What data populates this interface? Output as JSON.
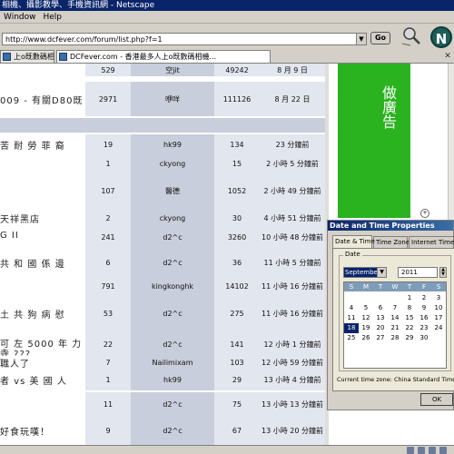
{
  "window": {
    "title": "相機、攝影教學、手機資訊網 - Netscape"
  },
  "menu": {
    "items": [
      "Window",
      "Help"
    ]
  },
  "toolbar": {
    "url": "http://www.dcfever.com/forum/list.php?f=1",
    "go_label": "Go"
  },
  "tabs": [
    {
      "label": "上o既數碼相機..."
    },
    {
      "label": "DCFever.com - 香港最多人上o既數碼相機..."
    }
  ],
  "forum": {
    "rows": [
      {
        "title": "",
        "replies": "529",
        "author": "空jit",
        "views": "49242",
        "last": "8 月 9 日"
      },
      {
        "title": "009 - 有關D80既",
        "replies": "2971",
        "author": "咿咩",
        "views": "111126",
        "last": "8 月 22 日"
      },
      {
        "title": "苦 耐 勞 菲 裔",
        "replies": "19",
        "author": "hk99",
        "views": "134",
        "last": "23 分鐘前"
      },
      {
        "title": "",
        "replies": "1",
        "author": "ckyong",
        "views": "15",
        "last": "2 小時 5 分鐘前"
      },
      {
        "title": "",
        "replies": "107",
        "author": "醫德",
        "views": "1052",
        "last": "2 小時 49 分鐘前"
      },
      {
        "title": "天祥黑店",
        "replies": "2",
        "author": "ckyong",
        "views": "30",
        "last": "4 小時 51 分鐘前"
      },
      {
        "title": "G II",
        "replies": "241",
        "author": "d2^c",
        "views": "3260",
        "last": "10 小時 48 分鐘前"
      },
      {
        "title": "共 和 國 係 邊",
        "replies": "6",
        "author": "d2^c",
        "views": "36",
        "last": "11 小時 5 分鐘前"
      },
      {
        "title": "",
        "replies": "791",
        "author": "kingkonghk",
        "views": "14102",
        "last": "11 小時 16 分鐘前"
      },
      {
        "title": "土 共 狗 病 慰",
        "replies": "53",
        "author": "d2^c",
        "views": "275",
        "last": "11 小時 16 分鐘前"
      },
      {
        "title": "可 左 5000 年 力",
        "title2": "寺 ???",
        "replies": "22",
        "author": "d2^c",
        "views": "141",
        "last": "12 小時 1 分鐘前"
      },
      {
        "title": "職人了",
        "replies": "7",
        "author": "Nailimixam",
        "views": "103",
        "last": "12 小時 59 分鐘前"
      },
      {
        "title": "者 vs 美 國 人",
        "replies": "1",
        "author": "hk99",
        "views": "29",
        "last": "13 小時 4 分鐘前"
      },
      {
        "title": "",
        "replies": "11",
        "author": "d2^c",
        "views": "75",
        "last": "13 小時 13 分鐘前"
      },
      {
        "title": "好食玩嘆！",
        "replies": "9",
        "author": "d2^c",
        "views": "67",
        "last": "13 小時 20 分鐘前"
      }
    ]
  },
  "ad": {
    "text": "做廣告",
    "color": "#2ab21f"
  },
  "dialog": {
    "title": "Date and Time Properties",
    "tabs": [
      "Date & Time",
      "Time Zone",
      "Internet Time"
    ],
    "date_group_label": "Date",
    "month": "September",
    "year": "2011",
    "weekday_headers": [
      "S",
      "M",
      "T",
      "W",
      "T",
      "F",
      "S"
    ],
    "days": [
      "",
      "",
      "",
      "",
      "1",
      "2",
      "3",
      "4",
      "5",
      "6",
      "7",
      "8",
      "9",
      "10",
      "11",
      "12",
      "13",
      "14",
      "15",
      "16",
      "17",
      "18",
      "19",
      "20",
      "21",
      "22",
      "23",
      "24",
      "25",
      "26",
      "27",
      "28",
      "29",
      "30",
      ""
    ],
    "selected_day": "18",
    "timezone_text": "Current time zone:  China Standard Time",
    "ok_label": "OK"
  }
}
